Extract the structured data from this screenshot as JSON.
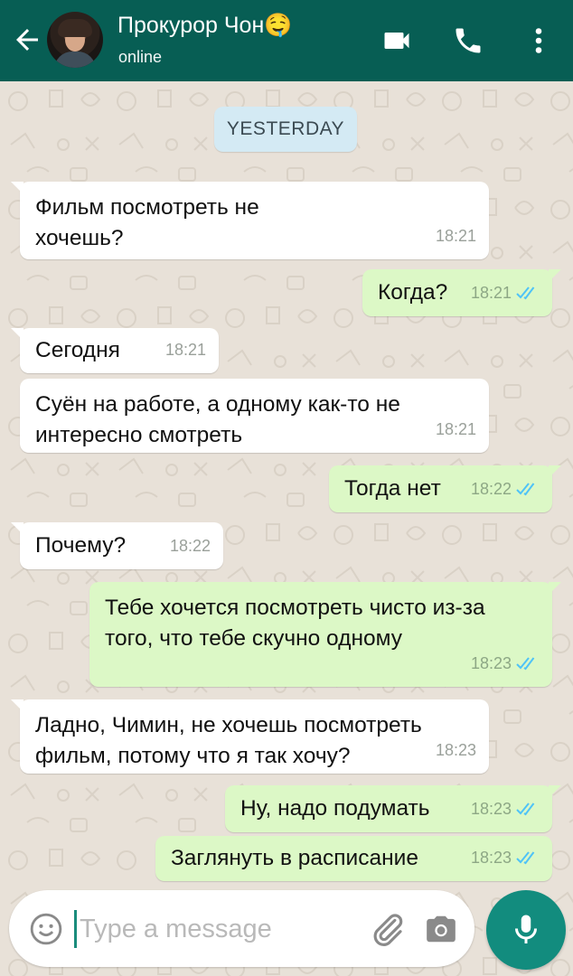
{
  "header": {
    "contact_name": "Прокурор Чон🤤",
    "status": "online",
    "icons": [
      "back-arrow-icon",
      "video-call-icon",
      "phone-icon",
      "more-vert-icon"
    ]
  },
  "chat": {
    "date_chip": "YESTERDAY",
    "messages": [
      {
        "direction": "in",
        "text": "Фильм посмотреть не хочешь?",
        "time": "18:21"
      },
      {
        "direction": "out",
        "text": "Когда?",
        "time": "18:21",
        "read": true
      },
      {
        "direction": "in",
        "text": "Сегодня",
        "time": "18:21"
      },
      {
        "direction": "in",
        "text": "Суён на работе, а одному как-то не интересно смотреть",
        "time": "18:21"
      },
      {
        "direction": "out",
        "text": "Тогда нет",
        "time": "18:22",
        "read": true
      },
      {
        "direction": "in",
        "text": "Почему?",
        "time": "18:22"
      },
      {
        "direction": "out",
        "text": "Тебе хочется посмотреть чисто из-за того, что тебе скучно одному",
        "time": "18:23",
        "read": true
      },
      {
        "direction": "in",
        "text": "Ладно, Чимин, не хочешь посмотреть фильм, потому что я так хочу?",
        "time": "18:23"
      },
      {
        "direction": "out",
        "text": "Ну, надо подумать",
        "time": "18:23",
        "read": true
      },
      {
        "direction": "out",
        "text": "Заглянуть в расписание",
        "time": "18:23",
        "read": true
      }
    ]
  },
  "composer": {
    "placeholder": "Type a message",
    "value": "",
    "icons": [
      "emoji-icon",
      "attach-icon",
      "camera-icon",
      "mic-icon"
    ]
  },
  "colors": {
    "header": "#075e54",
    "incoming_bubble": "#ffffff",
    "outgoing_bubble": "#dcf8c6",
    "read_ticks": "#4fc3f7",
    "mic_button": "#128c7e"
  }
}
